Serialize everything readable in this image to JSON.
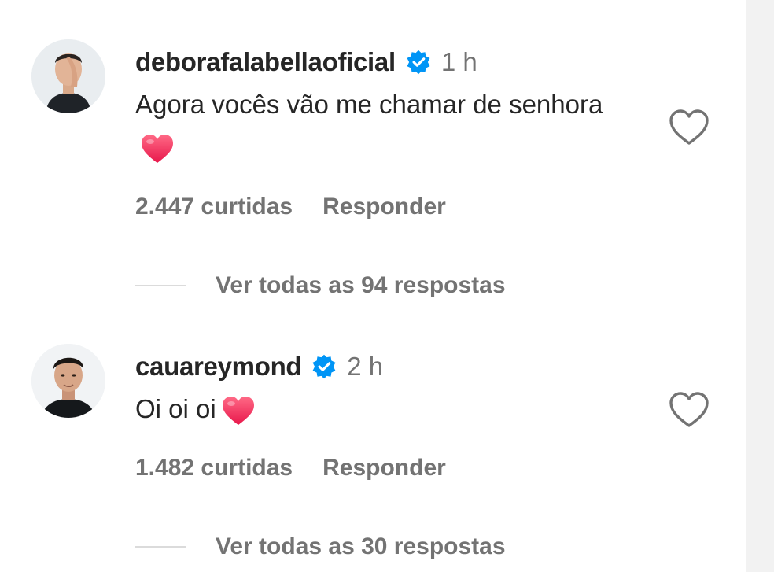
{
  "comments": [
    {
      "username": "deborafalabellaoficial",
      "time": "1 h",
      "text": "Agora vocês vão me chamar de senhora",
      "likes": "2.447 curtidas",
      "reply_label": "Responder",
      "view_replies": "Ver todas as 94 respostas"
    },
    {
      "username": "cauareymond",
      "time": "2 h",
      "text": "Oi oi oi",
      "likes": "1.482 curtidas",
      "reply_label": "Responder",
      "view_replies": "Ver todas as 30 respostas"
    }
  ],
  "colors": {
    "verified": "#0095f6",
    "heart_emoji": "#f0365f",
    "muted_text": "#737373",
    "primary_text": "#262626"
  },
  "icons": {
    "verified": "verified-badge-icon",
    "like": "heart-outline-icon",
    "emoji": "red-heart-emoji"
  }
}
